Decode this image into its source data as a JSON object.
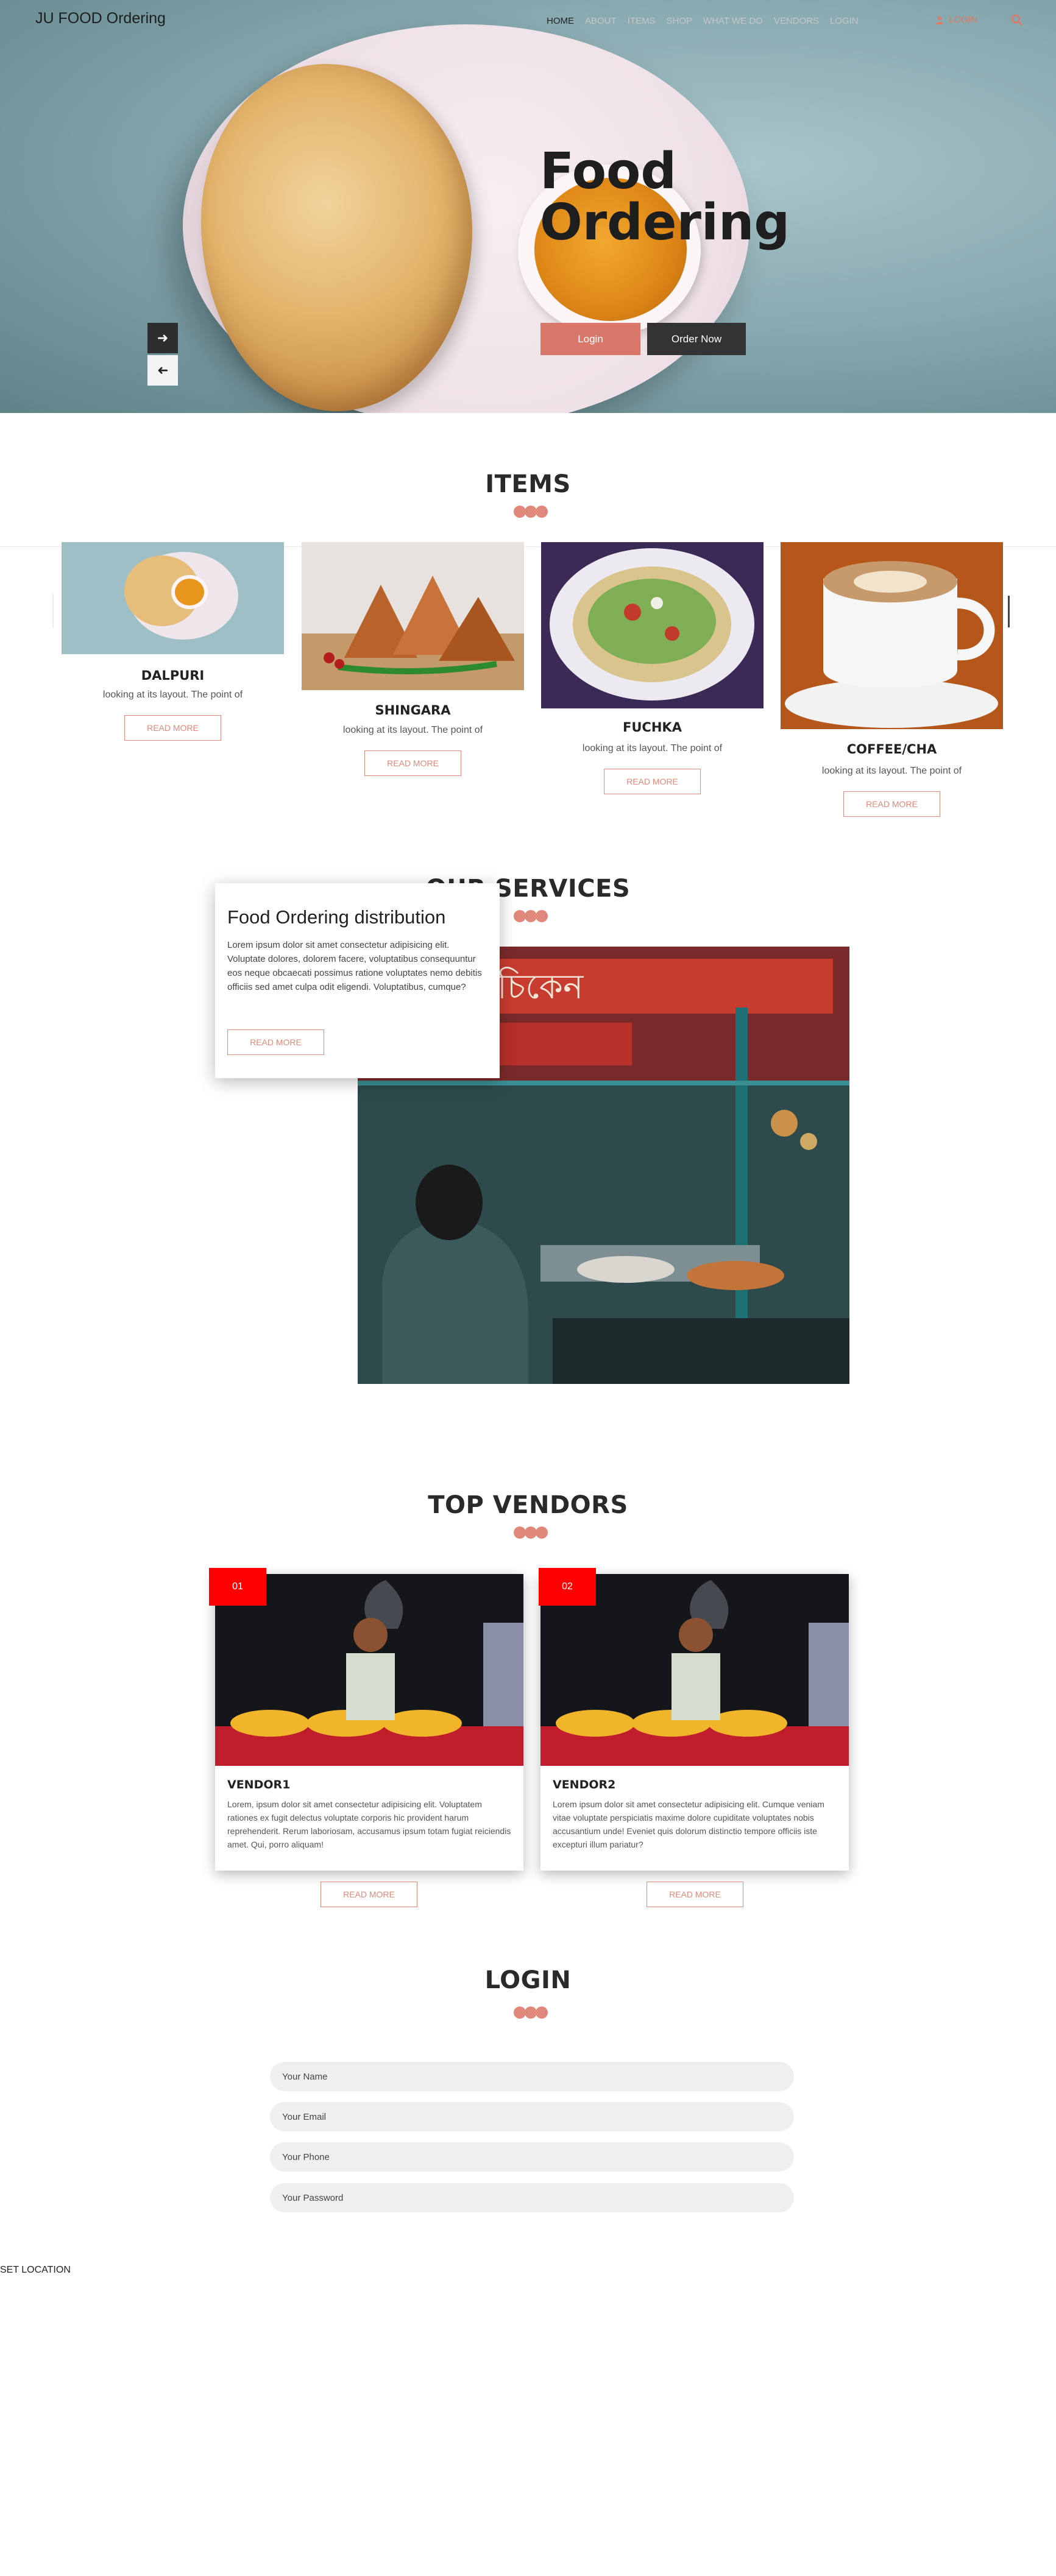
{
  "navbar": {
    "brand": "JU FOOD Ordering",
    "links": [
      "HOME",
      "ABOUT",
      "ITEMS",
      "SHOP",
      "WHAT WE DO",
      "VENDORS",
      "LOGIN"
    ],
    "login_label": "LOGIN",
    "search_icon": "search-icon",
    "user_icon": "user-icon"
  },
  "hero": {
    "title_line1": "Food",
    "title_line2": "Ordering",
    "login_button": "Login",
    "order_button": "Order Now",
    "next_icon": "arrow-right-icon",
    "prev_icon": "arrow-left-icon"
  },
  "items": {
    "title": "ITEMS",
    "cards": [
      {
        "name": "DALPURI",
        "desc": "looking at its layout. The point of",
        "button": "READ MORE"
      },
      {
        "name": "SHINGARA",
        "desc": "looking at its layout. The point of",
        "button": "READ MORE"
      },
      {
        "name": "FUCHKA",
        "desc": "looking at its layout. The point of",
        "button": "READ MORE"
      },
      {
        "name": "COFFEE/CHA",
        "desc": "looking at its layout. The point of",
        "button": "READ MORE"
      }
    ]
  },
  "services": {
    "title": "OUR SERVICES",
    "card_title": "Food Ordering distribution",
    "card_text": "Lorem ipsum dolor sit amet consectetur adipisicing elit. Voluptate dolores, dolorem facere, voluptatibus consequuntur eos neque obcaecati possimus ratione voluptates nemo debitis officiis sed amet culpa odit eligendi. Voluptatibus, cumque?",
    "card_button": "READ MORE"
  },
  "vendors": {
    "title": "TOP VENDORS",
    "cards": [
      {
        "badge": "01",
        "name": "VENDOR1",
        "text": "Lorem, ipsum dolor sit amet consectetur adipisicing elit. Voluptatem rationes ex fugit delectus voluptate corporis hic provident harum reprehenderit. Rerum laboriosam, accusamus ipsum totam fugiat reiciendis amet. Qui, porro aliquam!",
        "button": "READ MORE"
      },
      {
        "badge": "02",
        "name": "VENDOR2",
        "text": "Lorem ipsum dolor sit amet consectetur adipisicing elit. Cumque veniam vitae voluptate perspiciatis maxime dolore cupiditate voluptates nobis accusantium unde! Eveniet quis dolorum distinctio tempore officiis iste excepturi illum pariatur?",
        "button": "READ MORE"
      }
    ]
  },
  "login": {
    "title": "LOGIN",
    "name_placeholder": "Your Name",
    "email_placeholder": "Your Email",
    "phone_placeholder": "Your Phone",
    "password_placeholder": "Your Password"
  },
  "footer": {
    "set_location": "SET LOCATION"
  },
  "colors": {
    "accent": "#e0887a",
    "dark": "#333333",
    "badge": "#ff0000"
  }
}
